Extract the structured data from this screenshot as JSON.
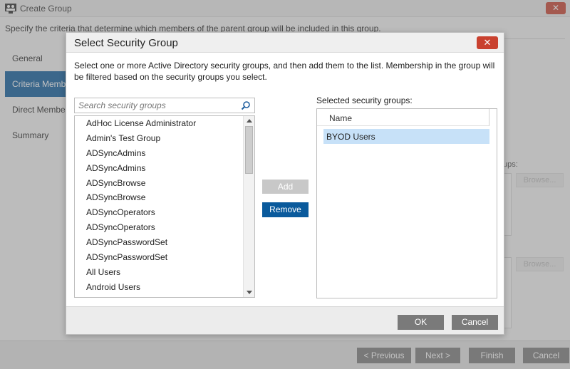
{
  "background_window": {
    "title": "Create Group",
    "close_label": "✕",
    "description": "Specify the criteria that determine which members of the parent group will be included in this group.",
    "nav": [
      {
        "label": "General"
      },
      {
        "label": "Criteria Memb"
      },
      {
        "label": "Direct Membe"
      },
      {
        "label": "Summary"
      }
    ],
    "right_label": "ups:",
    "browse_label": "Browse...",
    "footer": {
      "previous": "< Previous",
      "next": "Next >",
      "finish": "Finish",
      "cancel": "Cancel"
    }
  },
  "dialog": {
    "title": "Select Security Group",
    "close_label": "✕",
    "intro": "Select one or more Active Directory security groups, and then add them to the list. Membership in the group will be filtered based on the security groups you select.",
    "search": {
      "placeholder": "Search security groups",
      "value": ""
    },
    "groups": [
      "AdHoc License Administrator",
      "Admin's Test Group",
      "ADSyncAdmins",
      "ADSyncAdmins",
      "ADSyncBrowse",
      "ADSyncBrowse",
      "ADSyncOperators",
      "ADSyncOperators",
      "ADSyncPasswordSet",
      "ADSyncPasswordSet",
      "All Users",
      "Android Users"
    ],
    "add_label": "Add",
    "remove_label": "Remove",
    "selected_label": "Selected security groups:",
    "selected_header": "Name",
    "selected": [
      "BYOD Users"
    ],
    "ok_label": "OK",
    "cancel_label": "Cancel"
  },
  "colors": {
    "accent": "#0a5a9c",
    "close": "#c9412f",
    "selection": "#c7e1f8",
    "button_gray": "#7a7a7a"
  }
}
